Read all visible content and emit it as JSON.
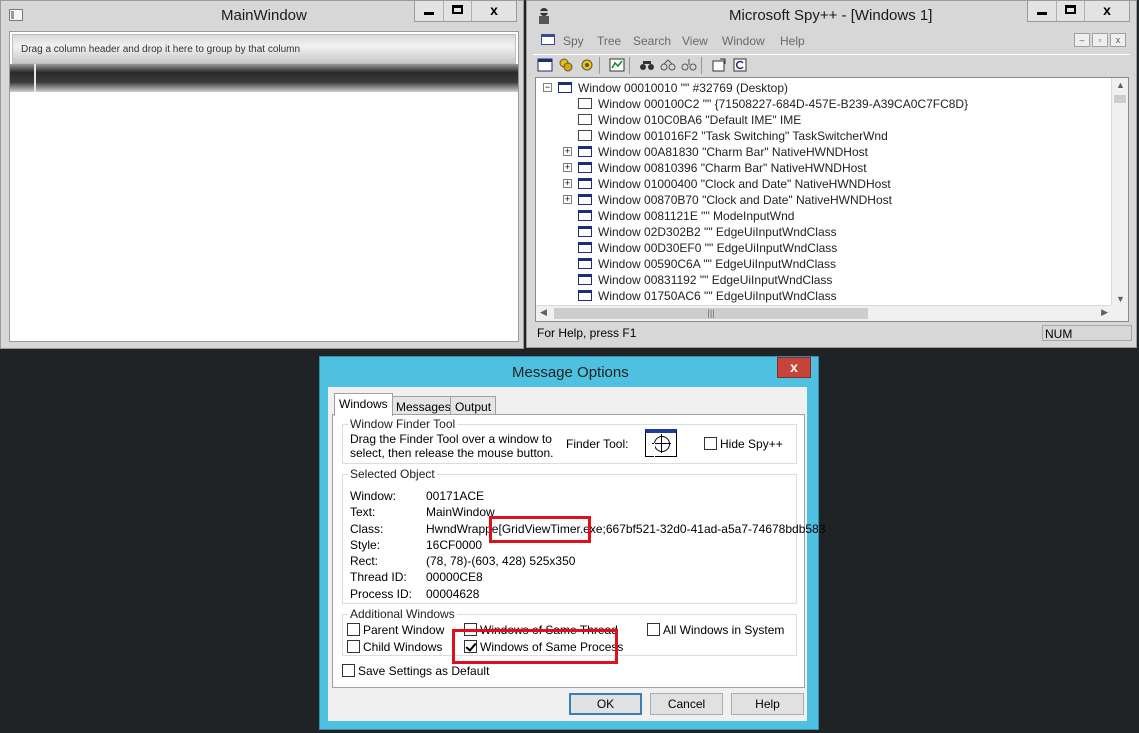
{
  "main_window": {
    "title": "MainWindow",
    "group_hint": "Drag a column header and drop it here to group by that column"
  },
  "spy": {
    "title": "Microsoft Spy++ - [Windows 1]",
    "menu": [
      "Spy",
      "Tree",
      "Search",
      "View",
      "Window",
      "Help"
    ],
    "toolbar_icons": [
      "windows-icon",
      "processes-icon",
      "threads-icon",
      "messages-icon",
      "find-window-icon",
      "find-icon",
      "find-next-icon",
      "properties-icon",
      "refresh-icon"
    ],
    "tree": [
      {
        "text": "Window 00010010 \"\" #32769 (Desktop)",
        "expander": "minus",
        "icon": "blue"
      },
      {
        "text": "Window 000100C2 \"\" {71508227-684D-457E-B239-A39CA0C7FC8D}",
        "expander": "",
        "icon": "plain"
      },
      {
        "text": "Window 010C0BA6 \"Default IME\" IME",
        "expander": "",
        "icon": "plain"
      },
      {
        "text": "Window 001016F2 \"Task Switching\" TaskSwitcherWnd",
        "expander": "",
        "icon": "plain"
      },
      {
        "text": "Window 00A81830 \"Charm Bar\" NativeHWNDHost",
        "expander": "plus",
        "icon": "blue"
      },
      {
        "text": "Window 00810396 \"Charm Bar\" NativeHWNDHost",
        "expander": "plus",
        "icon": "blue"
      },
      {
        "text": "Window 01000400 \"Clock and Date\" NativeHWNDHost",
        "expander": "plus",
        "icon": "blue"
      },
      {
        "text": "Window 00870B70 \"Clock and Date\" NativeHWNDHost",
        "expander": "plus",
        "icon": "blue"
      },
      {
        "text": "Window 0081121E \"\" ModeInputWnd",
        "expander": "",
        "icon": "blue"
      },
      {
        "text": "Window 02D302B2 \"\" EdgeUiInputWndClass",
        "expander": "",
        "icon": "blue"
      },
      {
        "text": "Window 00D30EF0 \"\" EdgeUiInputWndClass",
        "expander": "",
        "icon": "blue"
      },
      {
        "text": "Window 00590C6A \"\" EdgeUiInputWndClass",
        "expander": "",
        "icon": "blue"
      },
      {
        "text": "Window 00831192 \"\" EdgeUiInputWndClass",
        "expander": "",
        "icon": "blue"
      },
      {
        "text": "Window 01750AC6 \"\" EdgeUiInputWndClass",
        "expander": "",
        "icon": "blue"
      }
    ],
    "status_help": "For Help, press F1",
    "status_num": "NUM"
  },
  "dialog": {
    "title": "Message Options",
    "close_glyph": "x",
    "tabs": [
      "Windows",
      "Messages",
      "Output"
    ],
    "finder": {
      "group": "Window Finder Tool",
      "desc1": "Drag the Finder Tool over a window to",
      "desc2": "select, then release the mouse button.",
      "tool_label": "Finder Tool:",
      "hide_label": "Hide Spy++"
    },
    "selected": {
      "group": "Selected Object",
      "labels": [
        "Window:",
        "Text:",
        "Class:",
        "Style:",
        "Rect:",
        "Thread ID:",
        "Process ID:"
      ],
      "window": "00171ACE",
      "text": "MainWindow",
      "class_prefix": "HwndWrappe",
      "class_highlight": "[GridViewTimer.exe",
      "class_suffix": ";667bf521-32d0-41ad-a5a7-74678bdb583",
      "style": "16CF0000",
      "rect": "(78, 78)-(603, 428) 525x350",
      "thread_id": "00000CE8",
      "process_id": "00004628"
    },
    "additional": {
      "group": "Additional Windows",
      "parent": "Parent Window",
      "child": "Child Windows",
      "same_thread": "Windows of Same Thread",
      "same_process": "Windows of Same Process",
      "all_system": "All Windows in System"
    },
    "save_settings": "Save Settings as Default",
    "ok": "OK",
    "cancel": "Cancel",
    "help": "Help"
  }
}
